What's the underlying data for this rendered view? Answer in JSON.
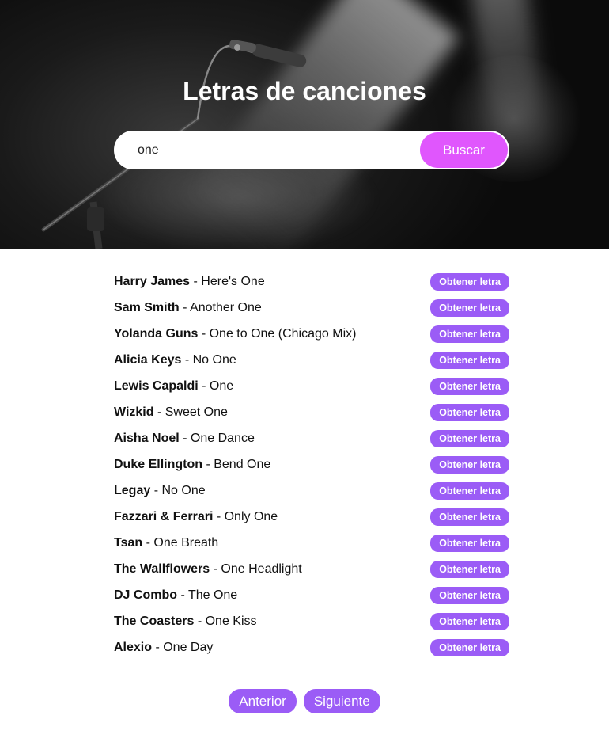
{
  "header": {
    "title": "Letras de canciones"
  },
  "search": {
    "value": "one",
    "button_label": "Buscar"
  },
  "colors": {
    "search_button": "#e056fd",
    "accent": "#9b5cf6"
  },
  "results": [
    {
      "artist": "Harry James",
      "title": "Here's One",
      "button": "Obtener letra"
    },
    {
      "artist": "Sam Smith",
      "title": "Another One",
      "button": "Obtener letra"
    },
    {
      "artist": "Yolanda Guns",
      "title": "One to One (Chicago Mix)",
      "button": "Obtener letra"
    },
    {
      "artist": "Alicia Keys",
      "title": "No One",
      "button": "Obtener letra"
    },
    {
      "artist": "Lewis Capaldi",
      "title": "One",
      "button": "Obtener letra"
    },
    {
      "artist": "Wizkid",
      "title": "Sweet One",
      "button": "Obtener letra"
    },
    {
      "artist": "Aisha Noel",
      "title": "One Dance",
      "button": "Obtener letra"
    },
    {
      "artist": "Duke Ellington",
      "title": "Bend One",
      "button": "Obtener letra"
    },
    {
      "artist": "Legay",
      "title": "No One",
      "button": "Obtener letra"
    },
    {
      "artist": "Fazzari & Ferrari",
      "title": "Only One",
      "button": "Obtener letra"
    },
    {
      "artist": "Tsan",
      "title": "One Breath",
      "button": "Obtener letra"
    },
    {
      "artist": "The Wallflowers",
      "title": "One Headlight",
      "button": "Obtener letra"
    },
    {
      "artist": "DJ Combo",
      "title": "The One",
      "button": "Obtener letra"
    },
    {
      "artist": "The Coasters",
      "title": "One Kiss",
      "button": "Obtener letra"
    },
    {
      "artist": "Alexio",
      "title": "One Day",
      "button": "Obtener letra"
    }
  ],
  "pagination": {
    "prev_label": "Anterior",
    "next_label": "Siguiente"
  }
}
